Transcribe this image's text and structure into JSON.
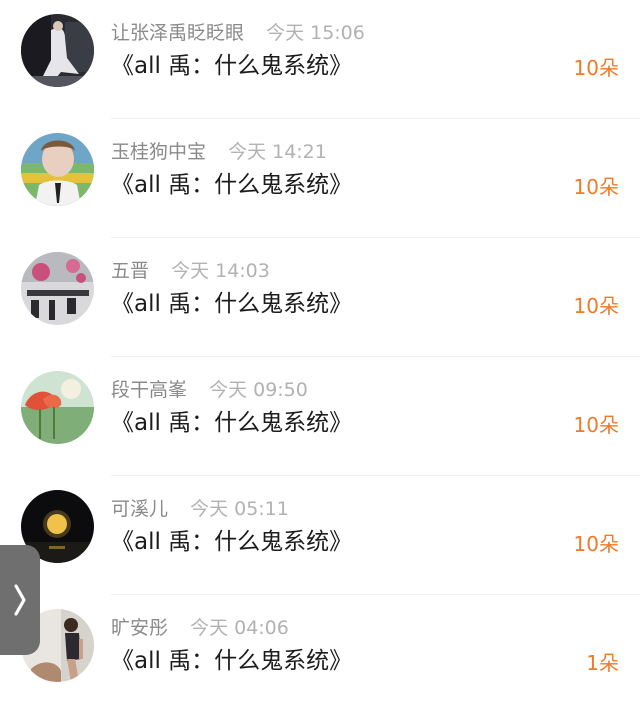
{
  "items": [
    {
      "name": "让张泽禹眨眨眼",
      "time": "今天 15:06",
      "book": "《all 禹：什么鬼系统》",
      "gift": "10朵",
      "avatar": "photo-avatar"
    },
    {
      "name": "玉桂狗中宝",
      "time": "今天 14:21",
      "book": "《all 禹：什么鬼系统》",
      "gift": "10朵",
      "avatar": "photo-avatar"
    },
    {
      "name": "五晋",
      "time": "今天 14:03",
      "book": "《all 禹：什么鬼系统》",
      "gift": "10朵",
      "avatar": "photo-avatar"
    },
    {
      "name": "段干高峯",
      "time": "今天 09:50",
      "book": "《all 禹：什么鬼系统》",
      "gift": "10朵",
      "avatar": "photo-avatar"
    },
    {
      "name": "可溪儿",
      "time": "今天 05:11",
      "book": "《all 禹：什么鬼系统》",
      "gift": "10朵",
      "avatar": "photo-avatar"
    },
    {
      "name": "旷安彤",
      "time": "今天 04:06",
      "book": "《all 禹：什么鬼系统》",
      "gift": "1朵",
      "avatar": "photo-avatar"
    }
  ],
  "side_tab": {
    "icon": "chevron-right-icon"
  },
  "colors": {
    "gift": "#f07a2a",
    "name": "#8a8a8a",
    "time": "#b2b2b2",
    "title": "#1c1c1c"
  }
}
